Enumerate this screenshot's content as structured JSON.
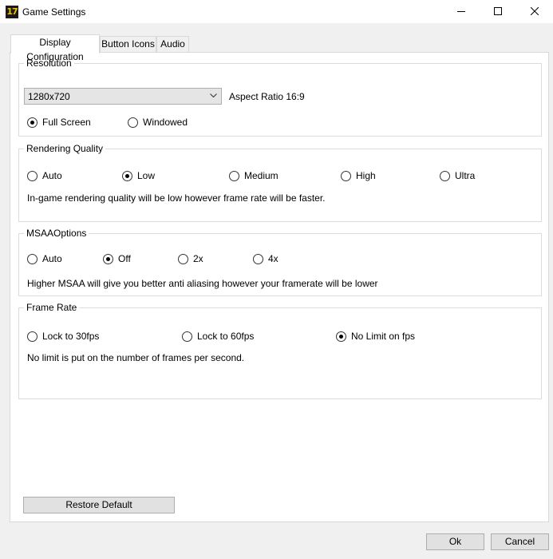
{
  "window": {
    "title": "Game Settings",
    "icon_label": "17"
  },
  "tabs": [
    {
      "label": "Display Configuration",
      "active": true
    },
    {
      "label": "Button Icons",
      "active": false
    },
    {
      "label": "Audio",
      "active": false
    }
  ],
  "resolution": {
    "title": "Resolution",
    "selected": "1280x720",
    "aspect_ratio": "Aspect Ratio 16:9",
    "modes": [
      {
        "label": "Full Screen",
        "checked": true
      },
      {
        "label": "Windowed",
        "checked": false
      }
    ]
  },
  "rendering_quality": {
    "title": "Rendering Quality",
    "options": [
      {
        "label": "Auto",
        "checked": false
      },
      {
        "label": "Low",
        "checked": true
      },
      {
        "label": "Medium",
        "checked": false
      },
      {
        "label": "High",
        "checked": false
      },
      {
        "label": "Ultra",
        "checked": false
      }
    ],
    "description": "In-game rendering quality will be low however frame rate will be faster."
  },
  "msaa": {
    "title": "MSAAOptions",
    "options": [
      {
        "label": "Auto",
        "checked": false
      },
      {
        "label": "Off",
        "checked": true
      },
      {
        "label": "2x",
        "checked": false
      },
      {
        "label": "4x",
        "checked": false
      }
    ],
    "description": "Higher MSAA will give you better anti aliasing however your framerate will be lower"
  },
  "frame_rate": {
    "title": "Frame Rate",
    "options": [
      {
        "label": "Lock  to 30fps",
        "checked": false
      },
      {
        "label": "Lock to 60fps",
        "checked": false
      },
      {
        "label": "No Limit on fps",
        "checked": true
      }
    ],
    "description": "No limit is put on the number of frames per second."
  },
  "buttons": {
    "restore_default": "Restore Default",
    "ok": "Ok",
    "cancel": "Cancel"
  }
}
